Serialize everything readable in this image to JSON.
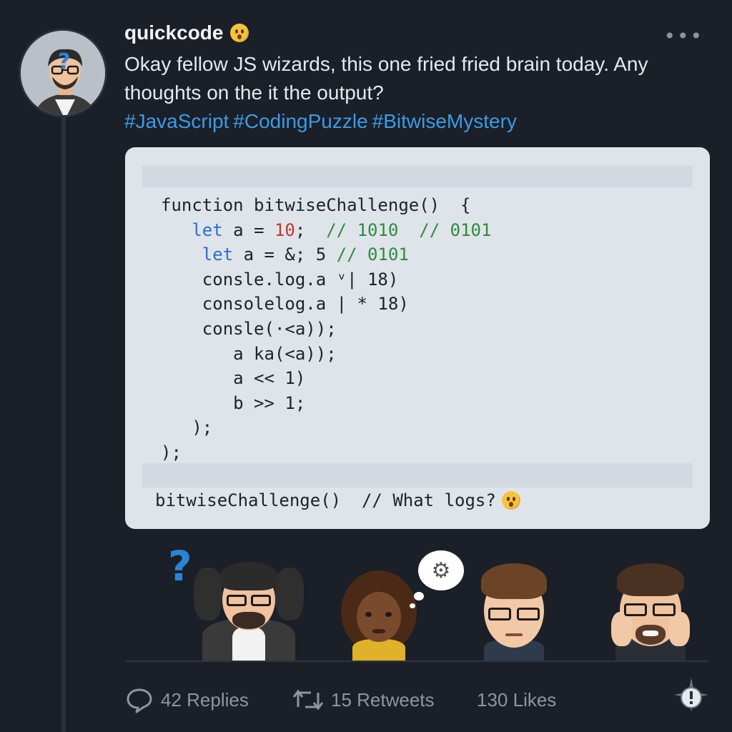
{
  "post": {
    "username": "quickcode",
    "username_emoji": "astonished-face-emoji",
    "text": "Okay fellow JS wizards, this one fried fried brain today. Any thoughts on the it the output?",
    "hashtags": [
      "#JavaScript",
      "#CodingPuzzle",
      "#BitwiseMystery"
    ],
    "more_icon": "more-horizontal-icon"
  },
  "code": {
    "lines": [
      {
        "indent": "",
        "parts": [
          {
            "t": "function bitwiseChallenge()  {",
            "c": ""
          }
        ]
      },
      {
        "indent": "   ",
        "parts": [
          {
            "t": "let",
            "c": "kw"
          },
          {
            "t": " a = ",
            "c": ""
          },
          {
            "t": "10",
            "c": "num"
          },
          {
            "t": ";  ",
            "c": ""
          },
          {
            "t": "// 1010  // 0101",
            "c": "cm"
          }
        ]
      },
      {
        "indent": "    ",
        "parts": [
          {
            "t": "let",
            "c": "kw"
          },
          {
            "t": " a = &; 5 ",
            "c": ""
          },
          {
            "t": "// 0101",
            "c": "cm"
          }
        ]
      },
      {
        "indent": "    ",
        "parts": [
          {
            "t": "consle.log.a ᵛ| 18)",
            "c": ""
          }
        ]
      },
      {
        "indent": "    ",
        "parts": [
          {
            "t": "consolelog.a | * 18)",
            "c": ""
          }
        ]
      },
      {
        "indent": "    ",
        "parts": [
          {
            "t": "consle(·<a));",
            "c": ""
          }
        ]
      },
      {
        "indent": "       ",
        "parts": [
          {
            "t": "a ka(<a));",
            "c": ""
          }
        ]
      },
      {
        "indent": "       ",
        "parts": [
          {
            "t": "a << 1)",
            "c": ""
          }
        ]
      },
      {
        "indent": "       ",
        "parts": [
          {
            "t": "b >> 1;",
            "c": ""
          }
        ]
      },
      {
        "indent": "   ",
        "parts": [
          {
            "t": ");",
            "c": ""
          }
        ]
      },
      {
        "indent": "",
        "parts": [
          {
            "t": ");",
            "c": ""
          }
        ]
      }
    ],
    "footer": "bitwiseChallenge()  // What logs?",
    "footer_emoji": "astonished-face-emoji"
  },
  "reactions": {
    "question_mark": "?",
    "thought_icon": "gears-icon"
  },
  "actions": {
    "replies": "42 Replies",
    "retweets": "15 Retweets",
    "likes": "130 Likes",
    "badge_icon": "alert-badge-icon"
  },
  "colors": {
    "background": "#1a1f28",
    "hashtag": "#3b9be6",
    "code_bg": "#dfe4ea",
    "keyword": "#2a6fd1",
    "number": "#c0392b",
    "comment": "#2e8b3e",
    "muted": "#8d96a1"
  }
}
